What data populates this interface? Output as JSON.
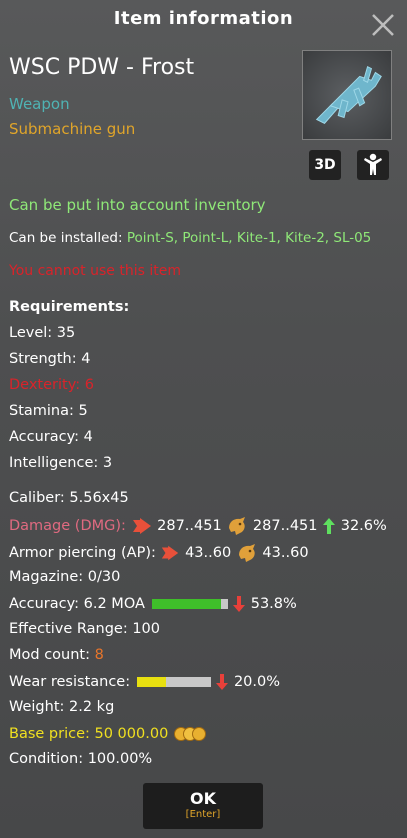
{
  "window": {
    "title": "Item information"
  },
  "item": {
    "name": "WSC PDW - Frost",
    "category": "Weapon",
    "subcategory": "Submachine gun",
    "view_3d_label": "3D"
  },
  "notes": {
    "account_inventory": "Can be put into account inventory",
    "installed_prefix": "Can be installed:",
    "installed_list": "Point-S, Point-L, Kite-1, Kite-2, SL-05",
    "cannot_use": "You cannot use this item"
  },
  "requirements": {
    "header": "Requirements:",
    "items": [
      {
        "label": "Level: 35",
        "unmet": false
      },
      {
        "label": "Strength: 4",
        "unmet": false
      },
      {
        "label": "Dexterity: 6",
        "unmet": true
      },
      {
        "label": "Stamina: 5",
        "unmet": false
      },
      {
        "label": "Accuracy: 4",
        "unmet": false
      },
      {
        "label": "Intelligence: 3",
        "unmet": false
      }
    ]
  },
  "stats": {
    "caliber": "Caliber: 5.56x45",
    "damage_label": "Damage (DMG):",
    "damage_val1": "287..451",
    "damage_val2": "287..451",
    "damage_change": "32.6%",
    "ap_label": "Armor piercing (AP):",
    "ap_val1": "43..60",
    "ap_val2": "43..60",
    "magazine": "Magazine: 0/30",
    "accuracy_label": "Accuracy: 6.2 MOA",
    "accuracy_fill": 0.92,
    "accuracy_change": "53.8%",
    "effective_range": "Effective Range: 100",
    "mod_count_label": "Mod count:",
    "mod_count_value": "8",
    "wear_label": "Wear resistance:",
    "wear_fill": 0.4,
    "wear_change": "20.0%",
    "weight": "Weight: 2.2 kg",
    "base_price_label": "Base price:",
    "base_price_value": "50 000.00",
    "condition": "Condition: 100.00%"
  },
  "buttons": {
    "ok_label": "OK",
    "ok_hint": "[Enter]"
  },
  "colors": {
    "accent_green": "#8fe878",
    "warning_red": "#d9232a",
    "damage_pink": "#e06a80",
    "category_teal": "#4fb3b3",
    "category_gold": "#e0a52a",
    "price_yellow": "#f0e020",
    "mod_orange": "#e8752b"
  }
}
